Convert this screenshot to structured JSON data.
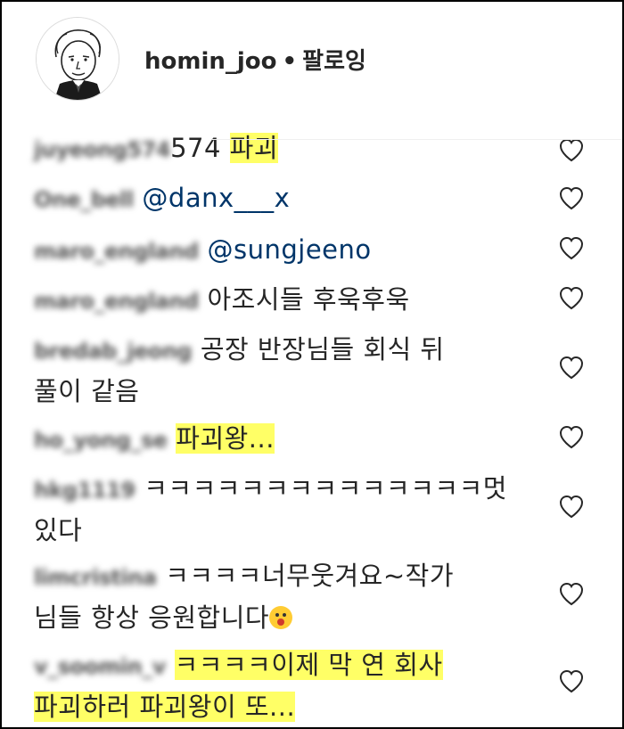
{
  "header": {
    "username": "homin_joo",
    "separator": "•",
    "follow_label": "팔로잉"
  },
  "comments": [
    {
      "user": "juyeong574",
      "prefix": "574 ",
      "text": "파괴",
      "highlight": true,
      "mention": ""
    },
    {
      "user": "One_bell",
      "text": "",
      "mention": "@danx___x",
      "highlight": false
    },
    {
      "user": "maro_england",
      "text": "",
      "mention": "@sungjeeno",
      "highlight": false
    },
    {
      "user": "maro_england",
      "text": "아조시들 후욱후욱",
      "mention": "",
      "highlight": false
    },
    {
      "user": "bredab_jeong",
      "text": "공장 반장님들 회식 뒤",
      "text2": "풀이 같음",
      "mention": "",
      "highlight": false
    },
    {
      "user": "ho_yong_se",
      "text": "파괴왕...",
      "mention": "",
      "highlight": true
    },
    {
      "user": "hkg1119",
      "text": "ㅋㅋㅋㅋㅋㅋㅋㅋㅋㅋㅋㅋㅋㅋ멋",
      "text2": "있다",
      "mention": "",
      "highlight": false
    },
    {
      "user": "limcristina",
      "text": "ㅋㅋㅋㅋ너무웃겨요~작가",
      "text2": "님들 항상 응원합니다",
      "emoji": "face-with-open-mouth-emoji",
      "mention": "",
      "highlight": false
    },
    {
      "user": "v_soomin_v",
      "text": "ㅋㅋㅋㅋ이제 막 연 회사",
      "text2": "파괴하러 파괴왕이 또...",
      "mention": "",
      "highlight": true
    }
  ],
  "colors": {
    "highlight": "#ffff66",
    "mention": "#003569",
    "text": "#262626",
    "heart_stroke": "#262626"
  },
  "icons": {
    "like": "heart-outline-icon"
  }
}
